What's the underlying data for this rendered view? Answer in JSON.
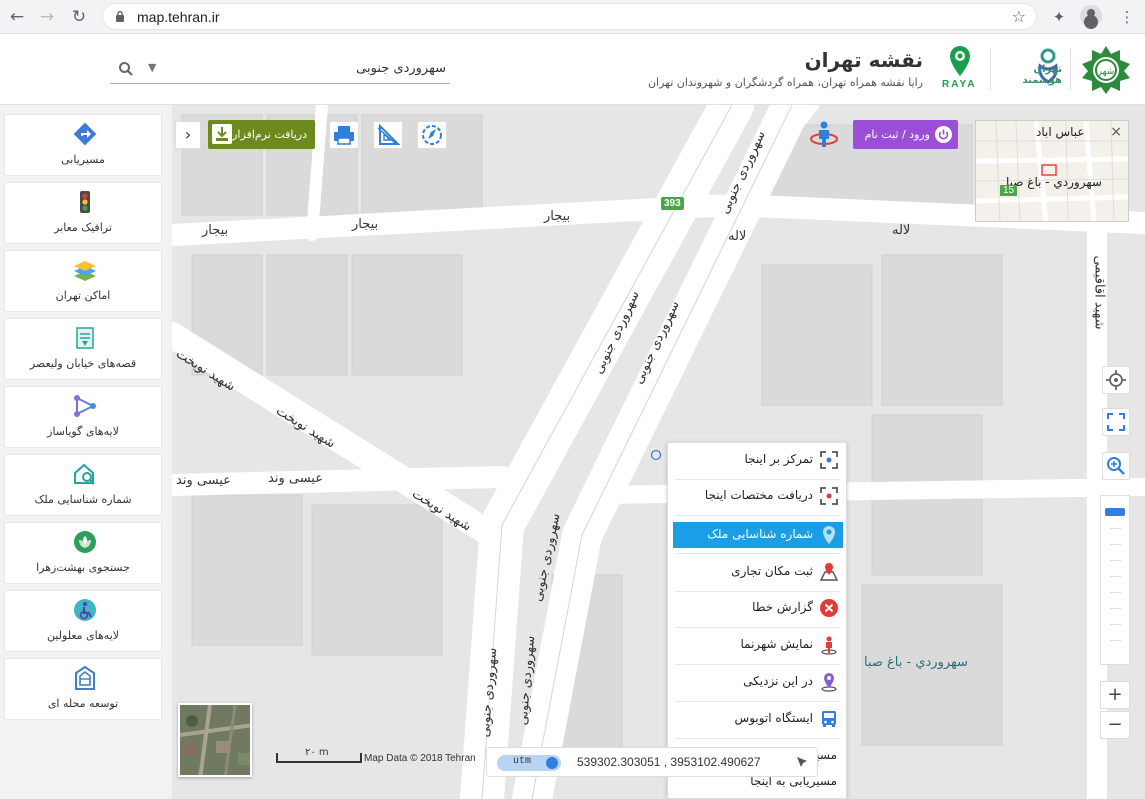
{
  "browser": {
    "url": "map.tehran.ir",
    "back_icon": "back-arrow-icon",
    "forward_icon": "forward-arrow-icon",
    "reload_icon": "reload-icon"
  },
  "header": {
    "search_value": "سهروردی جنوبی",
    "title": "نقشه تهران",
    "subtitle": "رایا نقشه همراه تهران، همراه گردشگران و شهروندان تهران",
    "raya_label": "RAYA",
    "smart_label": "تهران هوشمند"
  },
  "sidebar": {
    "items": [
      {
        "label": "مسیریابی",
        "icon": "route-icon"
      },
      {
        "label": "ترافیک معابر",
        "icon": "traffic-light-icon"
      },
      {
        "label": "اماکن تهران",
        "icon": "layers-icon"
      },
      {
        "label": "قصه‌های خیابان ولیعصر",
        "icon": "book-icon"
      },
      {
        "label": "لایه‌های گویاساز",
        "icon": "network-icon"
      },
      {
        "label": "شماره شناسایی ملک",
        "icon": "house-search-icon"
      },
      {
        "label": "جستجوی بهشت‌زهرا",
        "icon": "flower-icon"
      },
      {
        "label": "لایه‌های معلولین",
        "icon": "wheelchair-icon"
      },
      {
        "label": "توسعه محله ای",
        "icon": "building-icon"
      }
    ]
  },
  "toolbar": {
    "download_label": "دریافت نرم‌افزار",
    "login_label": "ورود / ثبت نام"
  },
  "minimap": {
    "label_top": "عباس اباد",
    "label_main": "سهروردي - باغ صبا",
    "badge": "15"
  },
  "map": {
    "route_badge": "393",
    "streets": {
      "bijar": "بیجار",
      "laleh": "لاله",
      "sohrevardi": "سهروردی جنوبی",
      "nobakht": "شهید نوبخت",
      "isavand": "عیسی وند",
      "aghaghi": "شهید اقاقیمی",
      "place": "سهروردي - باغ صبا"
    }
  },
  "context_menu": {
    "items": [
      {
        "label": "تمرکز بر اینجا",
        "icon": "focus-icon"
      },
      {
        "label": "دریافت مختصات اینجا",
        "icon": "coordinates-icon"
      },
      {
        "label": "شماره شناسایی ملک",
        "icon": "pin-icon",
        "active": true
      },
      {
        "label": "ثبت مکان تجاری",
        "icon": "map-pin-store-icon"
      },
      {
        "label": "گزارش خطا",
        "icon": "error-icon"
      },
      {
        "label": "نمایش شهرنما",
        "icon": "person-icon"
      },
      {
        "label": "در این نزدیکی",
        "icon": "nearby-icon"
      },
      {
        "label": "ایستگاه اتوبوس",
        "icon": "bus-icon"
      },
      {
        "label": "مسیریابی از اینجا",
        "icon": ""
      },
      {
        "label": "مسیریابی به اینجا",
        "icon": ""
      }
    ]
  },
  "coords": {
    "mode": "utm",
    "value": "539302.303051 , 3953102.490627"
  },
  "scale": {
    "label": "۲۰ m"
  },
  "attribution": "Map Data © 2018 Tehran",
  "colors": {
    "accent_purple": "#9b4fd6",
    "download_green": "#6d8a1e",
    "active_blue": "#1a9ee5"
  }
}
